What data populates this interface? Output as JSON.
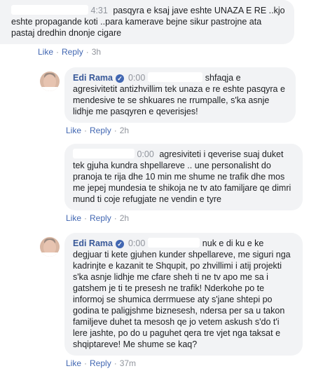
{
  "actions": {
    "like": "Like",
    "reply": "Reply",
    "separator": "·"
  },
  "comments": [
    {
      "time": "4:31",
      "text": "pasqyra e ksaj jave eshte UNAZA E RE ..kjo eshte propagande koti ..para kamerave bejne sikur pastrojne ata pastaj dredhin dnonje cigare",
      "age": "3h"
    },
    {
      "author": "Edi Rama",
      "time": "0:00",
      "text": "shfaqja e agresivitetit antizhvillim tek unaza e re eshte pasqyra e mendesive te se shkuares ne rrumpalle, s'ka asnje lidhje me pasqyren e qeverisjes!",
      "age": "2h"
    },
    {
      "time": "0:00",
      "text": "agresiviteti i qeverise suaj duket tek gjuha kundra shpellareve .. une personalisht do pranoja te rija dhe 10 min me shume ne trafik dhe mos me jepej mundesia te shikoja ne tv ato familjare qe dimri mund ti coje refugjate ne vendin e tyre",
      "age": "2h"
    },
    {
      "author": "Edi Rama",
      "time": "0:00",
      "text": "nuk e di ku e ke degjuar ti kete gjuhen kunder shpellareve, me siguri nga kadrinjte e kazanit te Shqupit, po zhvillimi i atij projekti s'ka asnje lidhje me cfare sheh ti ne tv apo me sa i gatshem je ti te presesh ne trafik! Nderkohe po te informoj se shumica derrmuese aty s'jane shtepi po godina te paligjshme biznesesh, ndersa per sa u takon familjeve duhet ta mesosh qe jo vetem askush s'do t'i lere jashte, po do u paguhet qera tre vjet nga taksat e shqiptareve! Me shume se kaq?",
      "age": "37m"
    }
  ]
}
